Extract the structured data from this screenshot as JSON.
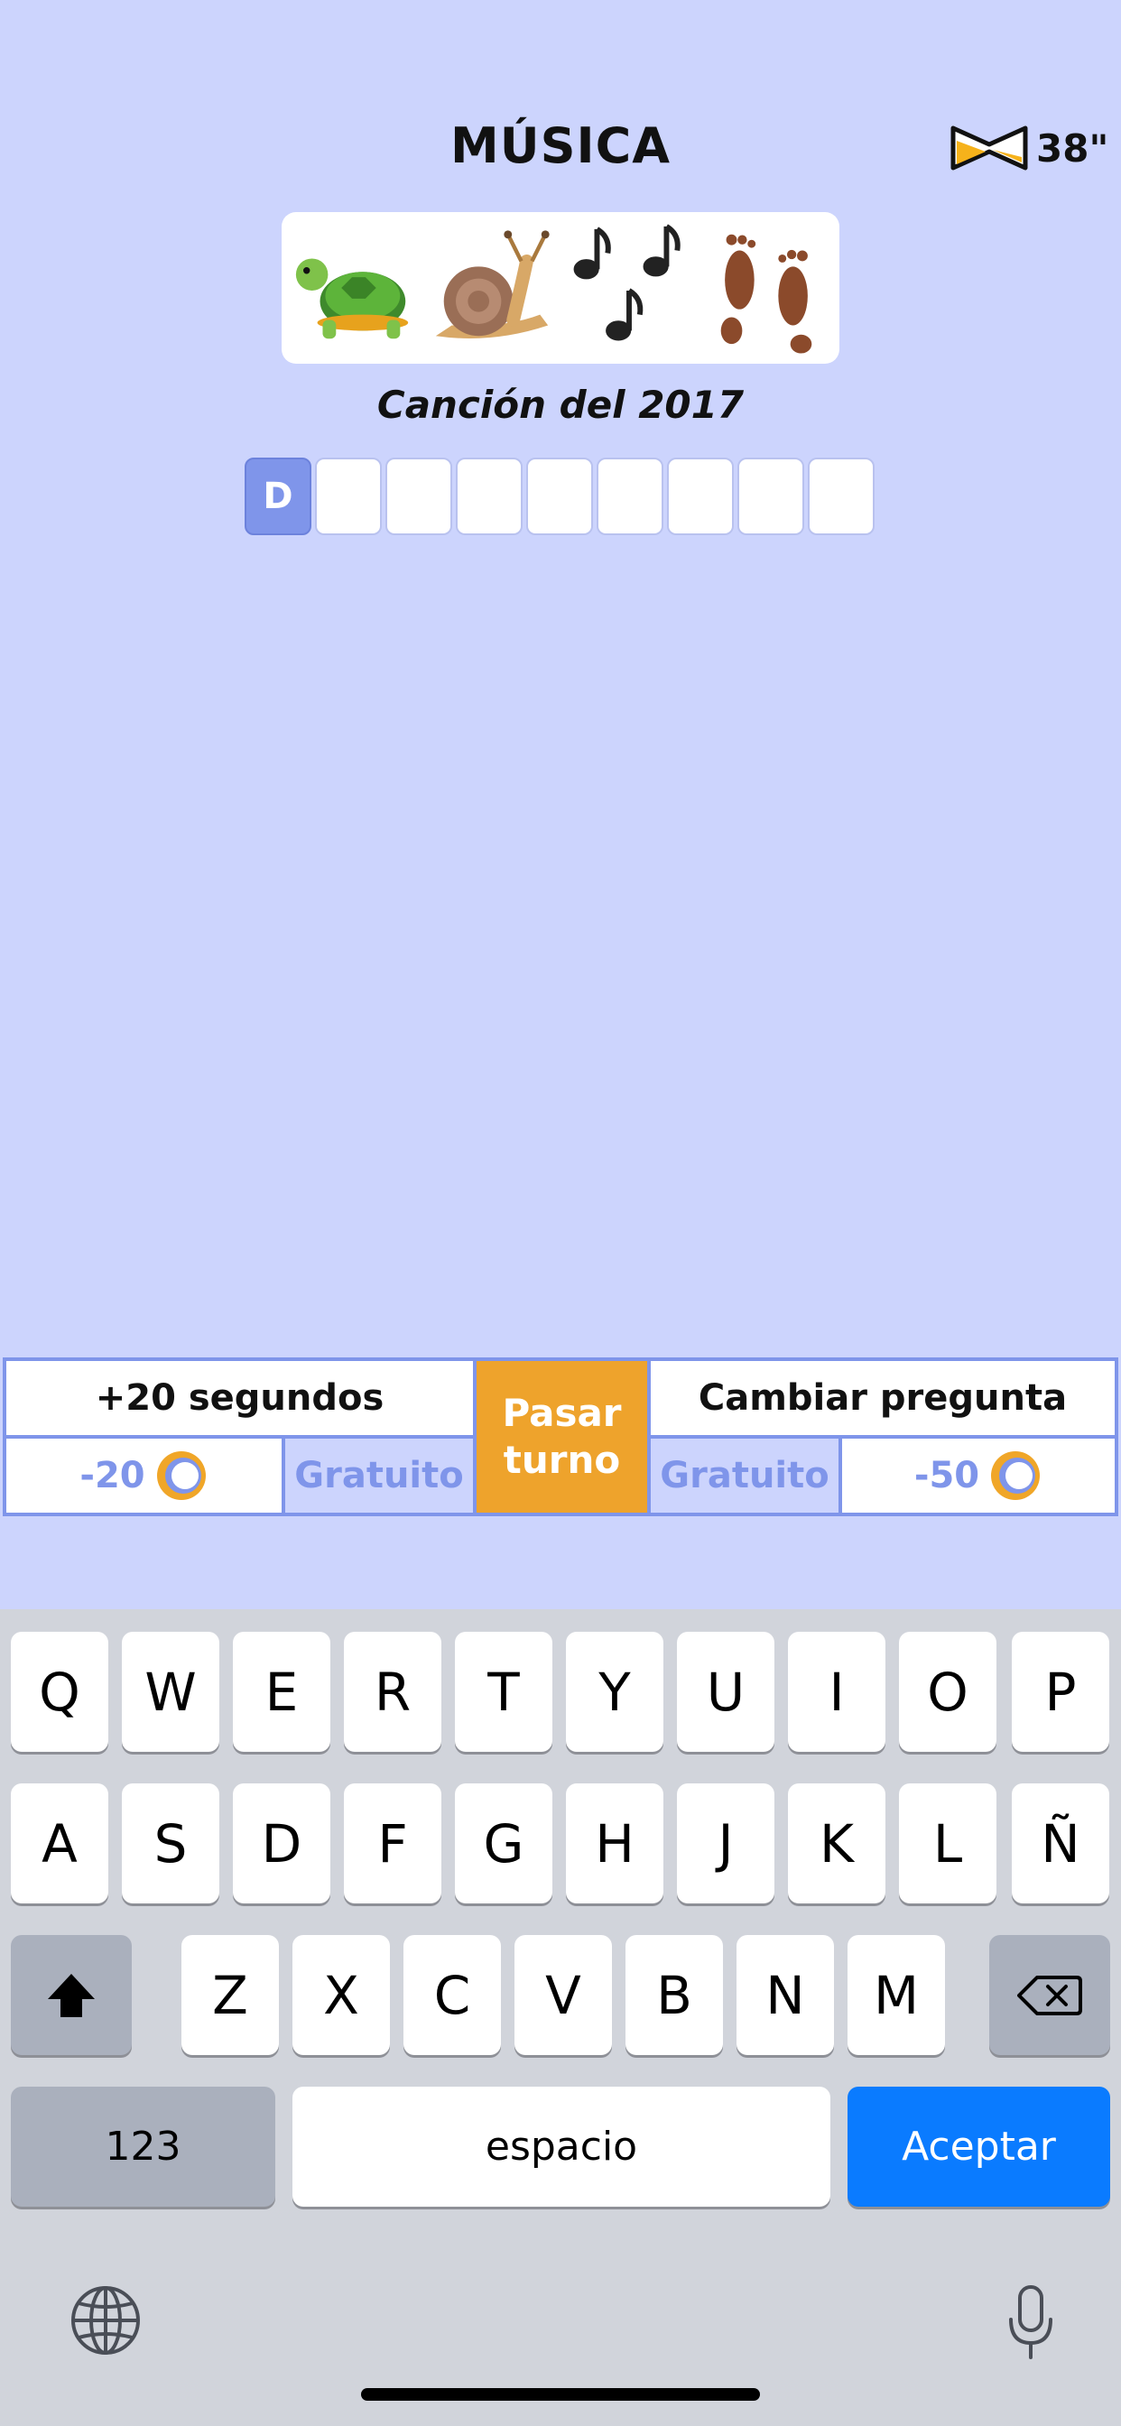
{
  "header": {
    "title": "MÚSICA",
    "timer": "38\""
  },
  "puzzle": {
    "emojis": [
      "turtle-emoji",
      "snail-emoji",
      "musical-notes-emoji",
      "footprints-emoji"
    ],
    "hint": "Canción del 2017",
    "answer_cells": [
      "D",
      "",
      "",
      "",
      "",
      "",
      "",
      "",
      ""
    ]
  },
  "powerups": {
    "time_title": "+20 segundos",
    "time_cost": "-20",
    "time_free": "Gratuito",
    "skip_line1": "Pasar",
    "skip_line2": "turno",
    "change_title": "Cambiar pregunta",
    "change_free": "Gratuito",
    "change_cost": "-50"
  },
  "keyboard": {
    "row1": [
      "Q",
      "W",
      "E",
      "R",
      "T",
      "Y",
      "U",
      "I",
      "O",
      "P"
    ],
    "row2": [
      "A",
      "S",
      "D",
      "F",
      "G",
      "H",
      "J",
      "K",
      "L",
      "Ñ"
    ],
    "row3": [
      "Z",
      "X",
      "C",
      "V",
      "B",
      "N",
      "M"
    ],
    "numbers_label": "123",
    "space_label": "espacio",
    "accept_label": "Aceptar"
  },
  "colors": {
    "background": "#ccd4fd",
    "accent": "#7f95ea",
    "skip": "#eea32c",
    "accept": "#0a7bff"
  }
}
